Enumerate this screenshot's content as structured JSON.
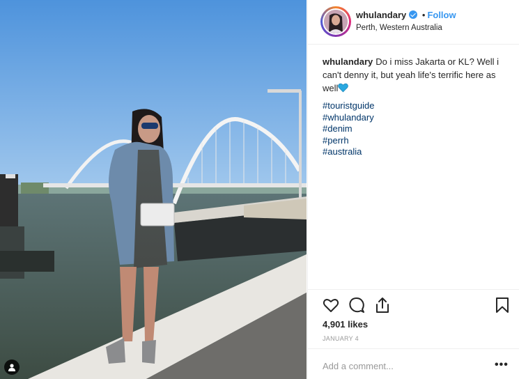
{
  "post": {
    "username": "whulandary",
    "follow_label": "Follow",
    "separator": "•",
    "location": "Perth, Western Australia",
    "caption_text": "Do i miss Jakarta or KL? Well i can't denny it, but yeah life's terrific here as well",
    "hashtags": [
      "#touristguide",
      "#whulandary",
      "#denim",
      "#perrh",
      "#australia"
    ],
    "likes": "4,901 likes",
    "date": "JANUARY 4",
    "comment_placeholder": "Add a comment...",
    "more_label": "•••"
  },
  "colors": {
    "link_blue": "#3897f0",
    "hashtag": "#003569",
    "muted": "#999999",
    "text": "#262626"
  },
  "icons": {
    "like": "heart-icon",
    "comment": "comment-icon",
    "share": "share-icon",
    "save": "bookmark-icon",
    "verified": "verified-badge-icon",
    "tagged_people": "person-tag-icon",
    "caption_emoji": "blue-heart-emoji-icon"
  }
}
